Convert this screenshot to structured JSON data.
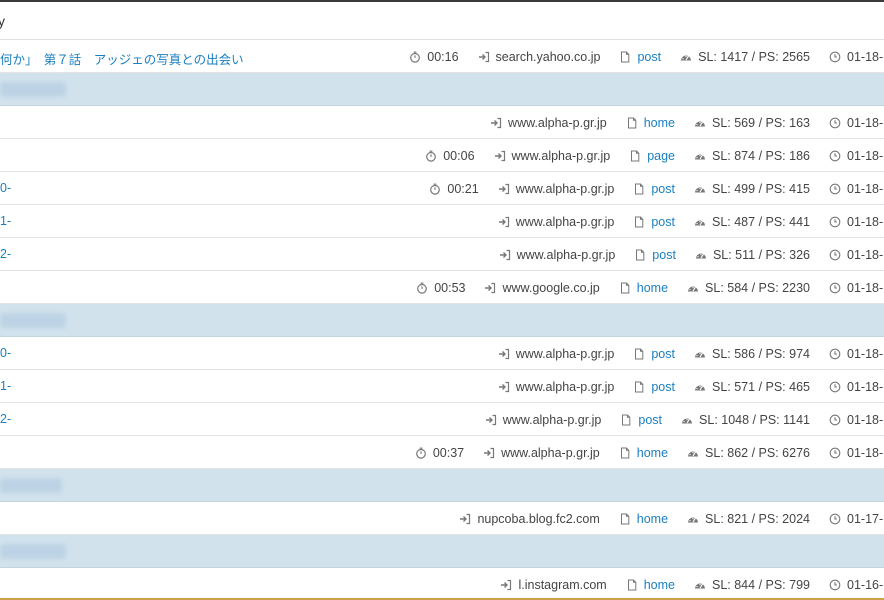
{
  "heading": {
    "text": "y"
  },
  "rows": [
    {
      "kind": "entry",
      "title": "何か」　第７話　アッジェの写真との出会い",
      "duration": "00:16",
      "referrer": "search.yahoo.co.jp",
      "page": "post",
      "stats": "SL: 1417 / PS: 2565",
      "date": "01-18-"
    },
    {
      "kind": "group",
      "blur_width": 66
    },
    {
      "kind": "entry",
      "title": "",
      "duration": "",
      "referrer": "www.alpha-p.gr.jp",
      "page": "home",
      "stats": "SL: 569 / PS: 163",
      "date": "01-18-"
    },
    {
      "kind": "entry",
      "title": "",
      "duration": "00:06",
      "referrer": "www.alpha-p.gr.jp",
      "page": "page",
      "stats": "SL: 874 / PS: 186",
      "date": "01-18-"
    },
    {
      "kind": "entry",
      "title": "0-",
      "duration": "00:21",
      "referrer": "www.alpha-p.gr.jp",
      "page": "post",
      "stats": "SL: 499 / PS: 415",
      "date": "01-18-"
    },
    {
      "kind": "entry",
      "title": "1-",
      "duration": "",
      "referrer": "www.alpha-p.gr.jp",
      "page": "post",
      "stats": "SL: 487 / PS: 441",
      "date": "01-18-"
    },
    {
      "kind": "entry",
      "title": "2-",
      "duration": "",
      "referrer": "www.alpha-p.gr.jp",
      "page": "post",
      "stats": "SL: 511 / PS: 326",
      "date": "01-18-"
    },
    {
      "kind": "entry",
      "title": "",
      "duration": "00:53",
      "referrer": "www.google.co.jp",
      "page": "home",
      "stats": "SL: 584 / PS: 2230",
      "date": "01-18-"
    },
    {
      "kind": "group",
      "blur_width": 66
    },
    {
      "kind": "entry",
      "title": "0-",
      "duration": "",
      "referrer": "www.alpha-p.gr.jp",
      "page": "post",
      "stats": "SL: 586 / PS: 974",
      "date": "01-18-"
    },
    {
      "kind": "entry",
      "title": "1-",
      "duration": "",
      "referrer": "www.alpha-p.gr.jp",
      "page": "post",
      "stats": "SL: 571 / PS: 465",
      "date": "01-18-"
    },
    {
      "kind": "entry",
      "title": "2-",
      "duration": "",
      "referrer": "www.alpha-p.gr.jp",
      "page": "post",
      "stats": "SL: 1048 / PS: 1141",
      "date": "01-18-"
    },
    {
      "kind": "entry",
      "title": "",
      "duration": "00:37",
      "referrer": "www.alpha-p.gr.jp",
      "page": "home",
      "stats": "SL: 862 / PS: 6276",
      "date": "01-18-"
    },
    {
      "kind": "group",
      "blur_width": 62
    },
    {
      "kind": "entry",
      "title": "",
      "duration": "",
      "referrer": "nupcoba.blog.fc2.com",
      "page": "home",
      "stats": "SL: 821 / PS: 2024",
      "date": "01-17-"
    },
    {
      "kind": "group",
      "blur_width": 66
    },
    {
      "kind": "entry",
      "title": "",
      "duration": "",
      "referrer": "l.instagram.com",
      "page": "home",
      "stats": "SL: 844 / PS: 799",
      "date": "01-16-"
    }
  ],
  "icons": {
    "duration": "stopwatch-icon",
    "referrer": "sign-in-icon",
    "page": "file-icon",
    "stats": "dashboard-icon",
    "date": "clock-icon"
  },
  "colors": {
    "link": "#1a7fc1",
    "group_bg": "#d2e2ec",
    "border": "#e3e3e3"
  }
}
